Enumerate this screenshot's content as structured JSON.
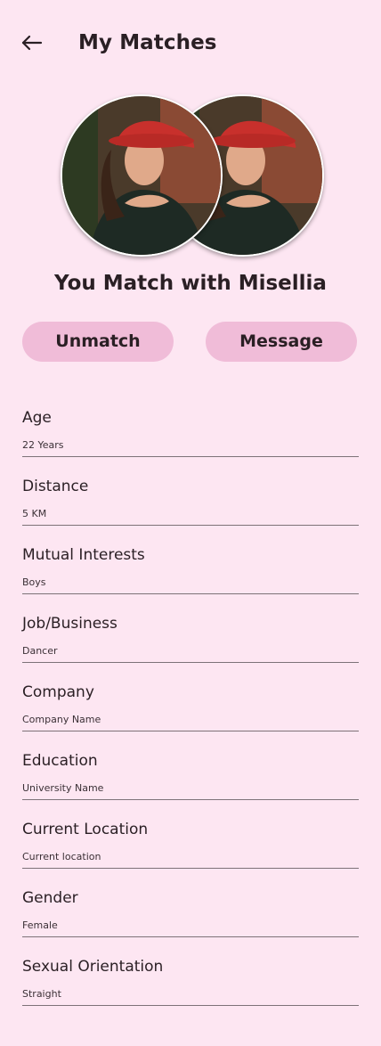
{
  "header": {
    "title": "My Matches",
    "back_icon": "arrow-left-icon"
  },
  "match": {
    "title": "You Match with Misellia"
  },
  "actions": {
    "unmatch_label": "Unmatch",
    "message_label": "Message"
  },
  "fields": [
    {
      "label": "Age",
      "value": "22 Years"
    },
    {
      "label": "Distance",
      "value": "5 KM"
    },
    {
      "label": "Mutual Interests",
      "value": "Boys"
    },
    {
      "label": "Job/Business",
      "value": "Dancer"
    },
    {
      "label": "Company",
      "value": "Company Name"
    },
    {
      "label": "Education",
      "value": "University Name"
    },
    {
      "label": "Current Location",
      "value": "Current location"
    },
    {
      "label": "Gender",
      "value": "Female"
    },
    {
      "label": "Sexual Orientation",
      "value": "Straight"
    }
  ],
  "colors": {
    "background": "#fde6f2",
    "button": "#f0bcd8",
    "text": "#2a1f24",
    "divider": "#7d7278"
  }
}
